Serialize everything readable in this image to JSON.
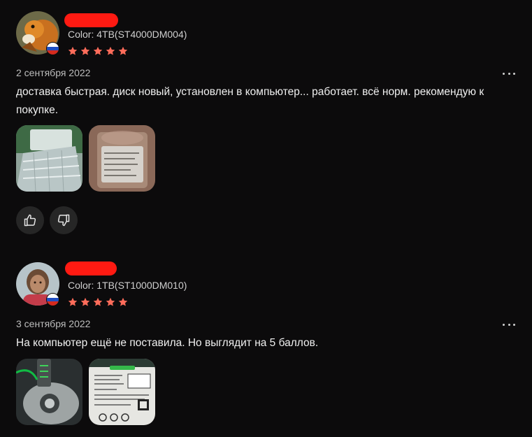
{
  "reviews": [
    {
      "color_text": "Color: 4TB(ST4000DM004)",
      "rating": 5,
      "date": "2 сентября 2022",
      "text": "доставка быстрая. диск новый, установлен в компьютер... работает. всё норм. рекомендую к покупке.",
      "country_flag": "ru-flag"
    },
    {
      "color_text": "Color: 1TB(ST1000DM010)",
      "rating": 5,
      "date": "3 сентября 2022",
      "text": "На компьютер ещё не поставила. Но выглядит на 5 баллов.",
      "country_flag": "ru-flag"
    }
  ],
  "colors": {
    "background": "#0c0b0c",
    "star": "#ff6c5a",
    "redaction": "#ff1a12",
    "vote_button": "#262626"
  },
  "icons": {
    "thumbs_up": "thumbs-up-icon",
    "thumbs_down": "thumbs-down-icon",
    "more": "more-horizontal-icon"
  }
}
